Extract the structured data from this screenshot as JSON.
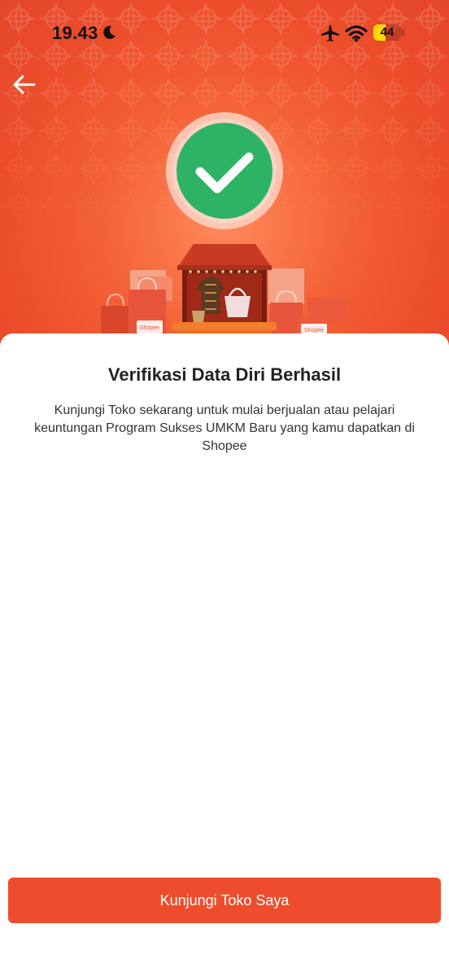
{
  "status_bar": {
    "time": "19.43",
    "battery_level": "44",
    "icons": [
      "moon-icon",
      "airplane-mode-icon",
      "wifi-icon",
      "battery-icon"
    ]
  },
  "header": {
    "back_icon": "arrow-left-icon"
  },
  "illustration": {
    "success_icon": "checkmark-circle-icon",
    "bag_logo_text": "Shopee"
  },
  "content": {
    "title": "Verifikasi Data Diri Berhasil",
    "description": "Kunjungi Toko sekarang untuk mulai berjualan atau pelajari keuntungan Program Sukses UMKM Baru yang kamu dapatkan di Shopee"
  },
  "actions": {
    "primary_label": "Kunjungi Toko Saya"
  },
  "colors": {
    "brand": "#ee4d2d",
    "success": "#2eb365",
    "battery_fill": "#ffd60a"
  }
}
